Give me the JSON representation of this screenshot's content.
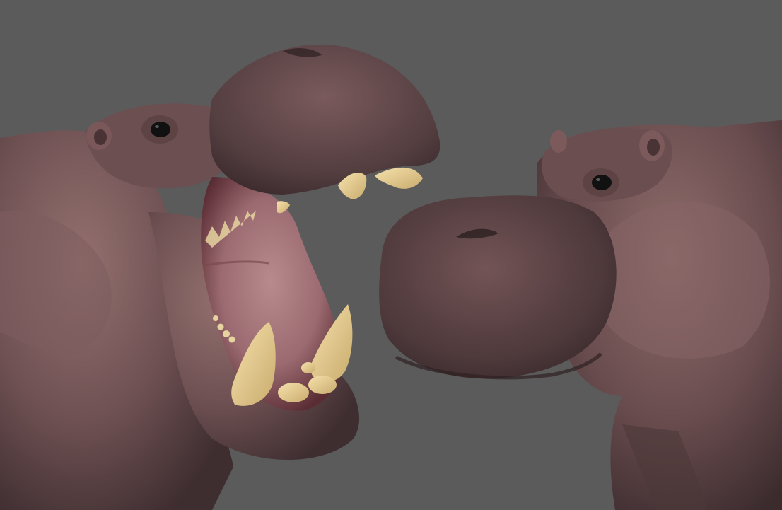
{
  "scene": {
    "background_color": "#5b5b5b",
    "subjects": [
      "hippo-open-mouth",
      "hippo-closed-mouth"
    ],
    "colors": {
      "skin_dark": "#4a3638",
      "skin_mid": "#6f5153",
      "skin_light": "#94706f",
      "mouth_inner": "#a8787c",
      "mouth_deep": "#5a2c33",
      "tusk": "#e9d29a",
      "eye": "#111111"
    }
  }
}
